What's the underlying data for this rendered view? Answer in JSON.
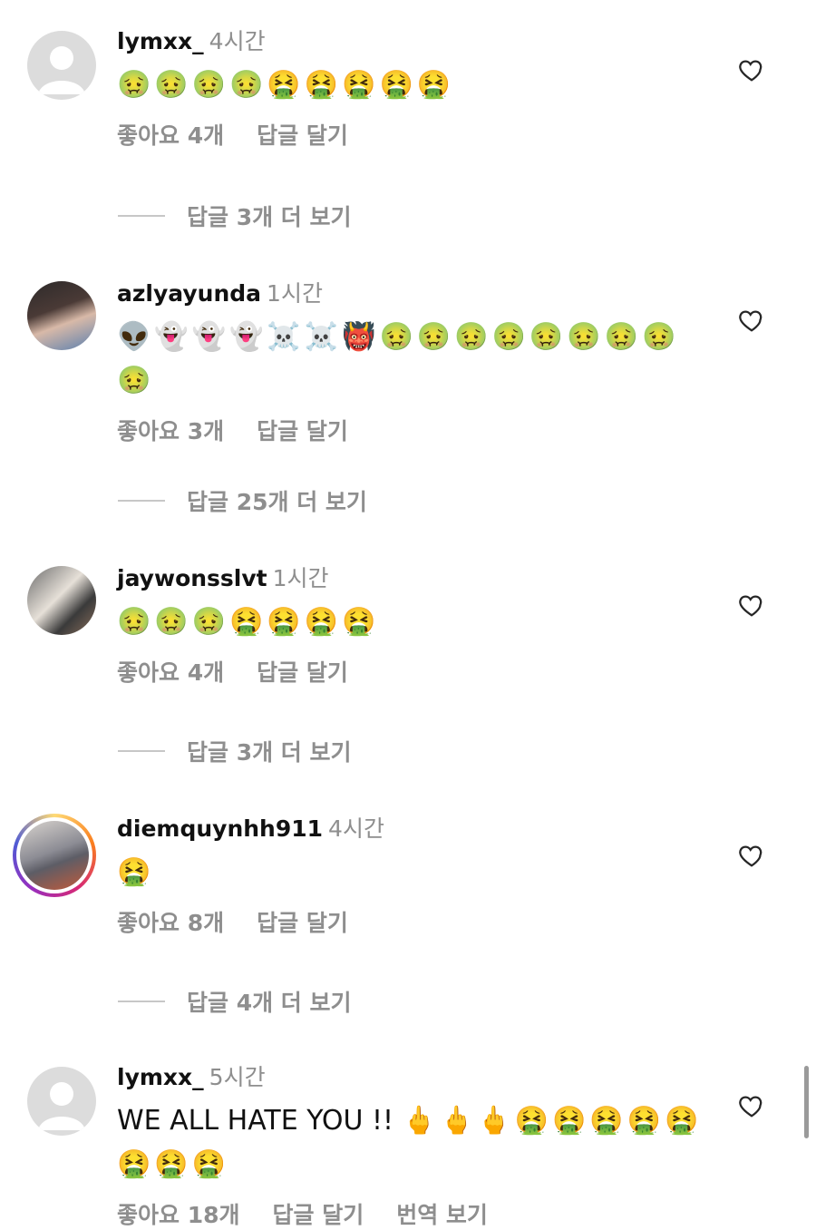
{
  "comments": [
    {
      "username": "lymxx_",
      "time": "4시간",
      "text": "🤢🤢🤢🤢🤮🤮🤮🤮🤮",
      "likes": "좋아요 4개",
      "reply": "답글 달기",
      "view_replies": "답글 3개 더 보기"
    },
    {
      "username": "azlyayunda",
      "time": "1시간",
      "text": "👽👻👻👻☠️☠️👹🤢🤢🤢🤢🤢🤢🤢🤢🤢",
      "likes": "좋아요 3개",
      "reply": "답글 달기",
      "view_replies": "답글 25개 더 보기"
    },
    {
      "username": "jaywonsslvt",
      "time": "1시간",
      "text": "🤢🤢🤢🤮🤮🤮🤮",
      "likes": "좋아요 4개",
      "reply": "답글 달기",
      "view_replies": "답글 3개 더 보기"
    },
    {
      "username": "diemquynhh911",
      "time": "4시간",
      "text": "🤮",
      "likes": "좋아요 8개",
      "reply": "답글 달기",
      "view_replies": "답글 4개 더 보기"
    },
    {
      "username": "lymxx_",
      "time": "5시간",
      "text_plain": "WE ALL HATE YOU !!",
      "text_emoji": "🖕🖕🖕🤮🤮🤮🤮🤮🤮🤮🤮",
      "likes": "좋아요 18개",
      "reply": "답글 달기",
      "translate": "번역 보기"
    }
  ],
  "icons": {
    "like": "heart-outline-icon",
    "avatar_default": "default-avatar-icon"
  }
}
